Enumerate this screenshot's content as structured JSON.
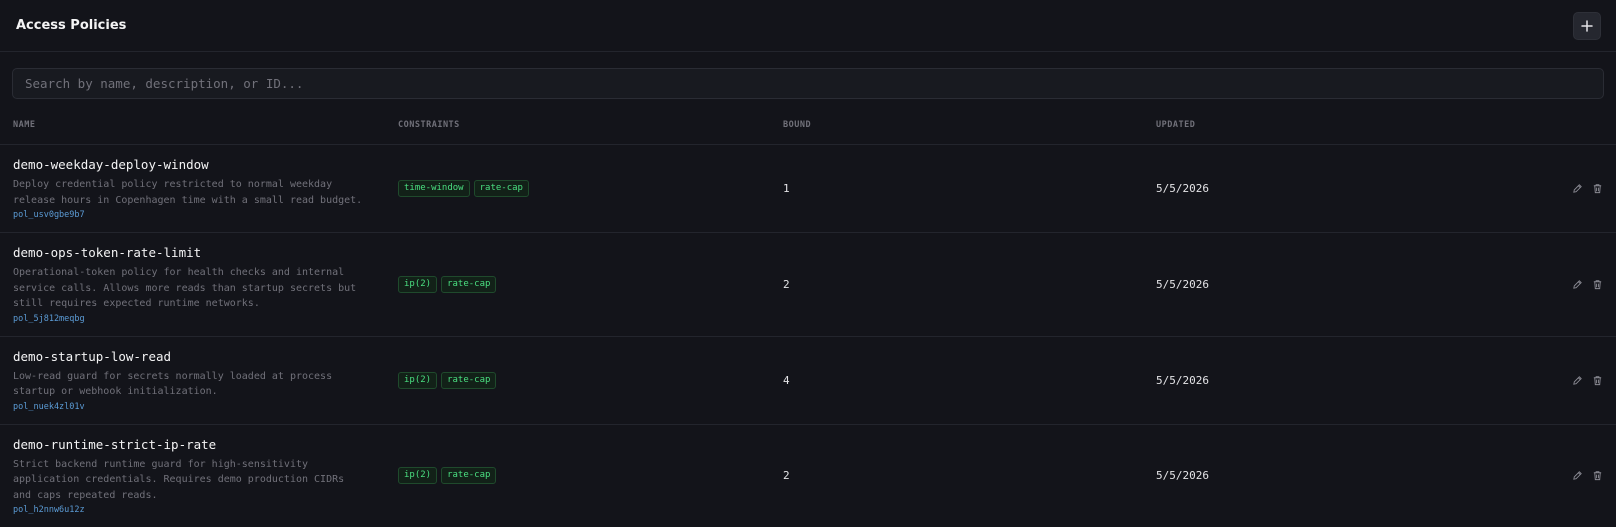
{
  "header": {
    "title": "Access Policies",
    "add_icon": "plus-icon"
  },
  "search": {
    "placeholder": "Search by name, description, or ID..."
  },
  "columns": {
    "name": "NAME",
    "constraints": "CONSTRAINTS",
    "bound": "BOUND",
    "updated": "UPDATED"
  },
  "policies": [
    {
      "name": "demo-weekday-deploy-window",
      "description": "Deploy credential policy restricted to normal weekday release hours in Copenhagen time with a small read budget.",
      "id": "pol_usv0gbe9b7",
      "constraints": [
        "time-window",
        "rate-cap"
      ],
      "bound": "1",
      "updated": "5/5/2026"
    },
    {
      "name": "demo-ops-token-rate-limit",
      "description": "Operational-token policy for health checks and internal service calls. Allows more reads than startup secrets but still requires expected runtime networks.",
      "id": "pol_5j812meqbg",
      "constraints": [
        "ip(2)",
        "rate-cap"
      ],
      "bound": "2",
      "updated": "5/5/2026"
    },
    {
      "name": "demo-startup-low-read",
      "description": "Low-read guard for secrets normally loaded at process startup or webhook initialization.",
      "id": "pol_nuek4zl01v",
      "constraints": [
        "ip(2)",
        "rate-cap"
      ],
      "bound": "4",
      "updated": "5/5/2026"
    },
    {
      "name": "demo-runtime-strict-ip-rate",
      "description": "Strict backend runtime guard for high-sensitivity application credentials. Requires demo production CIDRs and caps repeated reads.",
      "id": "pol_h2nnw6u12z",
      "constraints": [
        "ip(2)",
        "rate-cap"
      ],
      "bound": "2",
      "updated": "5/5/2026"
    }
  ],
  "colors": {
    "background": "#13141a",
    "tag_text": "#4ade80",
    "id_link": "#5b9bd5"
  }
}
